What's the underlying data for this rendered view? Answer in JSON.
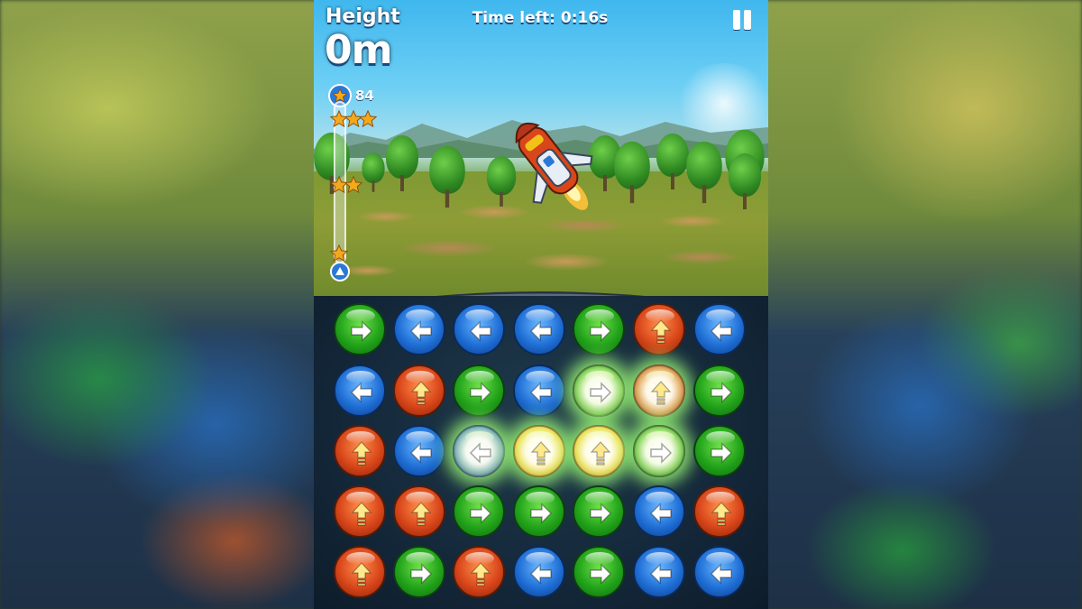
{
  "hud": {
    "height_label": "Height",
    "height_value": "0m",
    "timer": "Time left: 0:16s",
    "pause_icon": "pause-icon"
  },
  "progress": {
    "star_count": "84",
    "fill_fraction": 0.0,
    "milestones": [
      {
        "stars": 3,
        "level": 0.95
      },
      {
        "stars": 2,
        "level": 0.52
      },
      {
        "stars": 1,
        "level": 0.07
      }
    ]
  },
  "colors": {
    "green": "#22a31a",
    "blue": "#1f6fd6",
    "red": "#d8461a",
    "yellow": "#f2c21a",
    "star": "#f4a81c"
  },
  "board": {
    "rows": [
      [
        {
          "color": "green",
          "icon": "arrow-right-icon"
        },
        {
          "color": "blue",
          "icon": "arrow-left-icon"
        },
        {
          "color": "blue",
          "icon": "arrow-left-icon"
        },
        {
          "color": "blue",
          "icon": "arrow-left-icon"
        },
        {
          "color": "green",
          "icon": "arrow-right-icon"
        },
        {
          "color": "red",
          "icon": "arrow-up-icon"
        },
        {
          "color": "blue",
          "icon": "arrow-left-icon"
        }
      ],
      [
        {
          "color": "blue",
          "icon": "arrow-left-icon"
        },
        {
          "color": "red",
          "icon": "arrow-up-icon"
        },
        {
          "color": "green",
          "icon": "arrow-right-icon"
        },
        {
          "color": "blue",
          "icon": "arrow-left-icon"
        },
        {
          "color": "green",
          "icon": "arrow-right-icon"
        },
        {
          "color": "red",
          "icon": "arrow-up-icon"
        },
        {
          "color": "green",
          "icon": "arrow-right-icon"
        }
      ],
      [
        {
          "color": "red",
          "icon": "arrow-up-icon"
        },
        {
          "color": "blue",
          "icon": "arrow-left-icon"
        },
        {
          "color": "blue",
          "icon": "arrow-left-icon"
        },
        {
          "color": "yellow",
          "icon": "arrow-up-icon"
        },
        {
          "color": "yellow",
          "icon": "arrow-up-icon"
        },
        {
          "color": "green",
          "icon": "arrow-right-icon"
        },
        {
          "color": "green",
          "icon": "arrow-right-icon"
        }
      ],
      [
        {
          "color": "red",
          "icon": "arrow-up-icon"
        },
        {
          "color": "red",
          "icon": "arrow-up-icon"
        },
        {
          "color": "green",
          "icon": "arrow-right-icon"
        },
        {
          "color": "green",
          "icon": "arrow-right-icon"
        },
        {
          "color": "green",
          "icon": "arrow-right-icon"
        },
        {
          "color": "blue",
          "icon": "arrow-left-icon"
        },
        {
          "color": "red",
          "icon": "arrow-up-icon"
        }
      ],
      [
        {
          "color": "red",
          "icon": "arrow-up-icon"
        },
        {
          "color": "green",
          "icon": "arrow-right-icon"
        },
        {
          "color": "red",
          "icon": "arrow-up-icon"
        },
        {
          "color": "blue",
          "icon": "arrow-left-icon"
        },
        {
          "color": "green",
          "icon": "arrow-right-icon"
        },
        {
          "color": "blue",
          "icon": "arrow-left-icon"
        },
        {
          "color": "blue",
          "icon": "arrow-left-icon"
        }
      ]
    ],
    "match_chain": [
      [
        1,
        4
      ],
      [
        1,
        5
      ],
      [
        2,
        2
      ],
      [
        2,
        3
      ],
      [
        2,
        4
      ],
      [
        2,
        5
      ]
    ]
  },
  "scene": {
    "player_icon": "rocket-icon"
  }
}
